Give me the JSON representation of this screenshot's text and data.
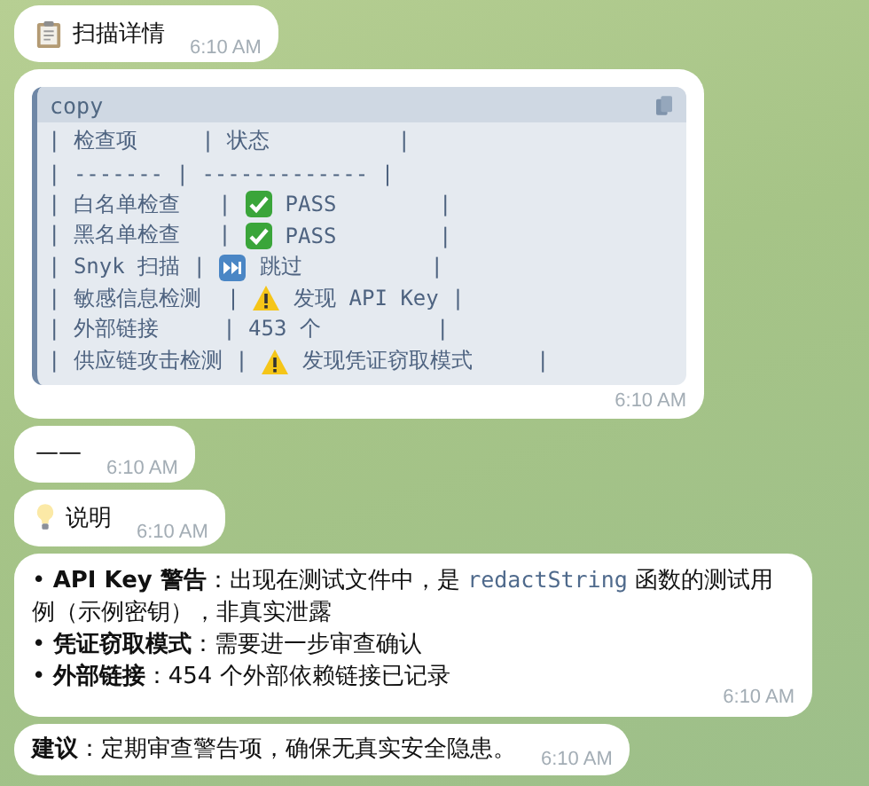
{
  "messages": [
    {
      "kind": "report",
      "text": "扫描详情",
      "time": "6:10 AM"
    },
    {
      "kind": "code",
      "language": "copy",
      "lines": [
        {
          "segments": [
            {
              "text": "| 检查项     | 状态          |"
            }
          ]
        },
        {
          "segments": [
            {
              "text": "| ------- | ------------- |"
            }
          ]
        },
        {
          "segments": [
            {
              "text": "| 白名单检查   | "
            },
            {
              "kind": "pass"
            },
            {
              "text": " PASS        |"
            }
          ]
        },
        {
          "segments": [
            {
              "text": "| 黑名单检查   | "
            },
            {
              "kind": "pass"
            },
            {
              "text": " PASS        |"
            }
          ]
        },
        {
          "segments": [
            {
              "text": "| Snyk 扫描 | "
            },
            {
              "kind": "skipped"
            },
            {
              "text": " 跳过          |"
            }
          ]
        },
        {
          "segments": [
            {
              "text": "| 敏感信息检测  | "
            },
            {
              "kind": "warning"
            },
            {
              "text": " 发现 API Key |"
            }
          ]
        },
        {
          "segments": [
            {
              "text": "| 外部链接     | 453 个         |"
            }
          ]
        },
        {
          "segments": [
            {
              "text": "| 供应链攻击检测 | "
            },
            {
              "kind": "warning"
            },
            {
              "text": " 发现凭证窃取模式     |"
            }
          ]
        }
      ],
      "time": "6:10 AM"
    },
    {
      "kind": "plain",
      "text": "——",
      "time": "6:10 AM"
    },
    {
      "kind": "tip",
      "text": "说明",
      "time": "6:10 AM"
    },
    {
      "kind": "paragraphs",
      "paragraphs": [
        [
          {
            "text": "• **API Key 警告**：出现在测试文件中，是 "
          },
          {
            "code": "redactString"
          },
          {
            "text": " 函数的测试用例（示例密钥），非真实泄露"
          }
        ],
        [
          {
            "text": "• **凭证窃取模式**：需要进一步审查确认"
          }
        ],
        [
          {
            "text": "• **外部链接**：454 个外部依赖链接已记录"
          }
        ]
      ],
      "time": "6:10 AM"
    },
    {
      "kind": "paragraphs",
      "paragraphs": [
        [
          {
            "text": "**建议**：定期审查警告项，确保无真实安全隐患。"
          }
        ]
      ],
      "time": "6:10 AM"
    }
  ]
}
